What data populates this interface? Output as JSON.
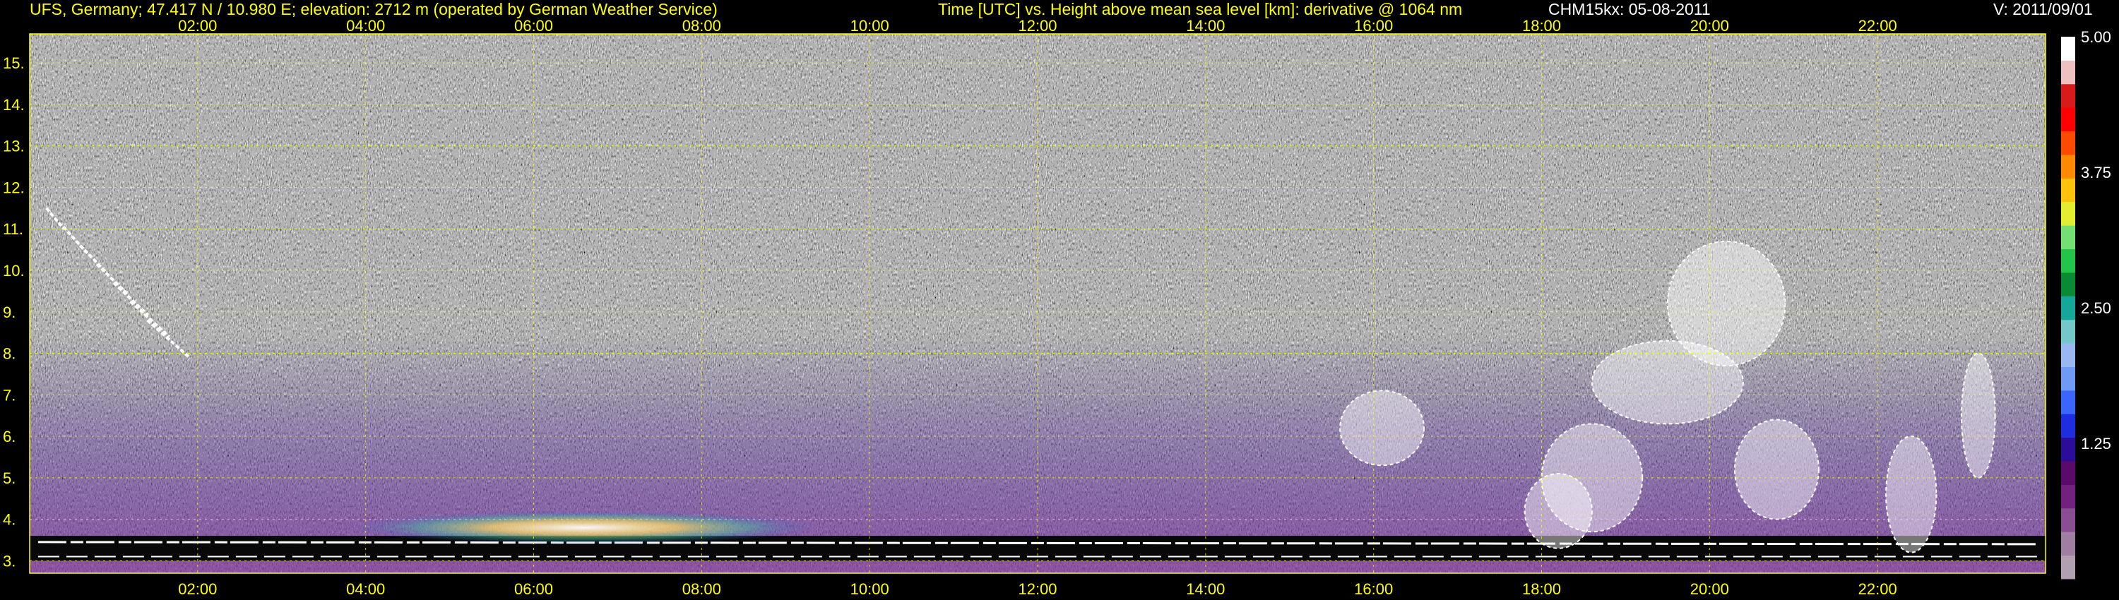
{
  "header": {
    "site": "UFS, Germany; 47.417 N / 10.980 E; elevation: 2712 m  (operated by German Weather Service)",
    "description": "Time [UTC] vs. Height above mean sea level [km]: derivative @ 1064 nm",
    "instrument": "CHM15kx: 05-08-2011",
    "version": "V: 2011/09/01"
  },
  "chart_data": {
    "type": "heatmap",
    "title": "Time [UTC] vs. Height above mean sea level [km]: derivative @ 1064 nm",
    "xlabel": "",
    "ylabel": "",
    "xlim": [
      0,
      24
    ],
    "ylim": [
      2.7,
      15.7
    ],
    "x_ticks": [
      "02:00",
      "04:00",
      "06:00",
      "08:00",
      "10:00",
      "12:00",
      "14:00",
      "16:00",
      "18:00",
      "20:00",
      "22:00"
    ],
    "x_tick_hours": [
      2,
      4,
      6,
      8,
      10,
      12,
      14,
      16,
      18,
      20,
      22
    ],
    "y_ticks": [
      "3.",
      "4.",
      "5.",
      "6.",
      "7.",
      "8.",
      "9.",
      "10.",
      "11.",
      "12.",
      "13.",
      "14.",
      "15."
    ],
    "y_tick_values": [
      3,
      4,
      5,
      6,
      7,
      8,
      9,
      10,
      11,
      12,
      13,
      14,
      15
    ],
    "grid": true,
    "colorbar": {
      "range": [
        0,
        5
      ],
      "tick_labels": [
        "1.25",
        "2.50",
        "3.75",
        "5.00"
      ],
      "tick_values": [
        1.25,
        2.5,
        3.75,
        5.0
      ],
      "colors": [
        "#b0a0b0",
        "#9e7fa1",
        "#8a4f93",
        "#74207f",
        "#5a0a6a",
        "#2a0e9a",
        "#1f2de0",
        "#3a66ff",
        "#6f9af5",
        "#9ab7f2",
        "#74c8c8",
        "#15a89a",
        "#0a8a34",
        "#23c44a",
        "#74e074",
        "#e4ee30",
        "#ffc20a",
        "#ff8a00",
        "#ff4a00",
        "#ff0000",
        "#d81a1a",
        "#efc0c0",
        "#ffffff"
      ]
    },
    "features": [
      {
        "name": "near-ground aerosol layer",
        "x_range": [
          0,
          24
        ],
        "y_range": [
          3.0,
          3.6
        ]
      },
      {
        "name": "early cloud streaks",
        "x_range": [
          0.2,
          1.7
        ],
        "y_range": [
          8.3,
          11.5
        ]
      },
      {
        "name": "bright aerosol plume",
        "x_range": [
          3.8,
          9.4
        ],
        "y_range": [
          3.4,
          4.2
        ]
      },
      {
        "name": "afternoon clouds",
        "x_range": [
          15.8,
          23.6
        ],
        "y_range": [
          3.3,
          12.3
        ]
      }
    ]
  }
}
